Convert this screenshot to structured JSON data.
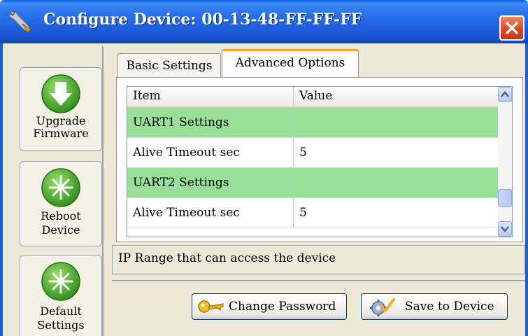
{
  "window": {
    "title": "Configure Device: 00-13-48-FF-FF-FF",
    "colors": {
      "titlebar": "#1f62e0",
      "close": "#d84a1e",
      "section_row": "#98e098",
      "active_tab_accent": "#ff9e2c"
    }
  },
  "sidebar": {
    "items": [
      {
        "label_line1": "Upgrade",
        "label_line2": "Firmware",
        "icon": "download-arrow-icon"
      },
      {
        "label_line1": "Reboot",
        "label_line2": "Device",
        "icon": "starburst-icon"
      },
      {
        "label_line1": "Default",
        "label_line2": "Settings",
        "icon": "starburst-icon"
      }
    ]
  },
  "tabs": [
    {
      "label": "Basic Settings",
      "active": false
    },
    {
      "label": "Advanced Options",
      "active": true
    }
  ],
  "grid": {
    "columns": [
      "Item",
      "Value"
    ],
    "rows": [
      {
        "item": "UART1 Settings",
        "value": "",
        "section": true
      },
      {
        "item": "Alive Timeout sec",
        "value": "5",
        "section": false
      },
      {
        "item": "UART2 Settings",
        "value": "",
        "section": true
      },
      {
        "item": "Alive Timeout sec",
        "value": "5",
        "section": false
      }
    ]
  },
  "description": "IP Range that can access the device",
  "actions": {
    "change_password": "Change Password",
    "save_to_device": "Save to Device"
  }
}
